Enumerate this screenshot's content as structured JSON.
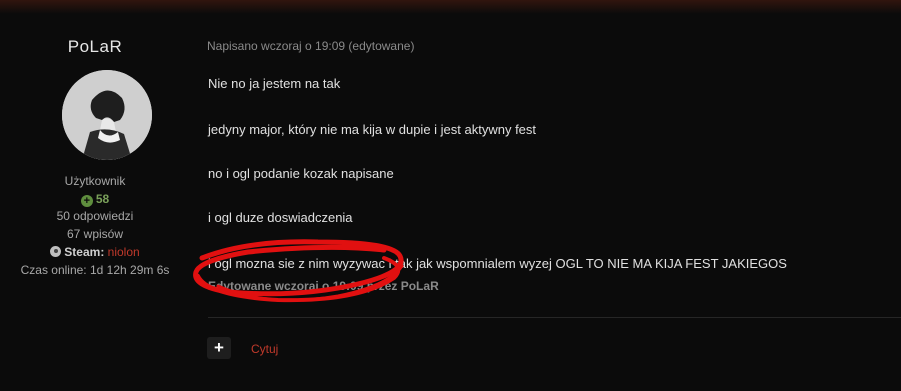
{
  "author": {
    "username": "PoLaR",
    "role": "Użytkownik",
    "reputation": "58",
    "posts_replies": "50 odpowiedzi",
    "posts_entries": "67 wpisów",
    "steam_label": "Steam:",
    "steam_value": "niolon",
    "online_time": "Czas online: 1d 12h 29m 6s"
  },
  "post": {
    "meta": "Napisano wczoraj o 19:09 (edytowane)",
    "paragraphs": [
      "Nie no ja jestem na tak",
      "jedyny major, który nie ma kija w dupie i jest aktywny fest",
      "no i ogl podanie kozak napisane",
      "i ogl duze doswiadczenia",
      "i ogl mozna sie z nim wyzywac i tak jak wspomnialem wyzej OGL TO NIE MA KIJA FEST JAKIEGOS"
    ],
    "edited_note": "Edytowane wczoraj o 19:09 przez PoLaR"
  },
  "actions": {
    "add_label": "+",
    "quote_label": "Cytuj"
  },
  "colors": {
    "background": "#0b0b0b",
    "accent_red": "#c0392b",
    "reputation_green": "#7aa05a",
    "annotation_red": "#e11010"
  }
}
